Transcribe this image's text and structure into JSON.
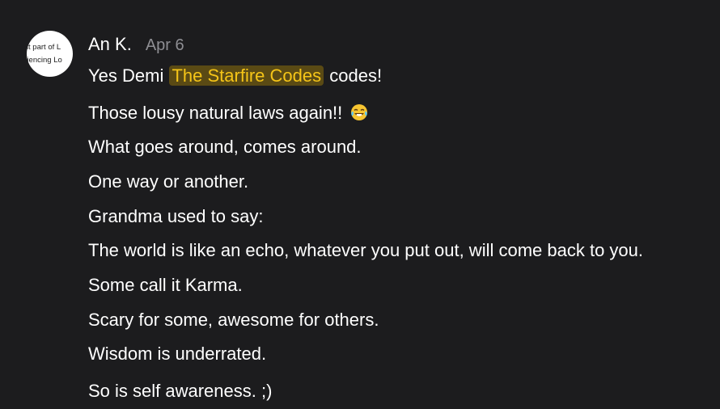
{
  "avatar": {
    "line1": "est part of L",
    "line2": "eriencing Lo"
  },
  "comment": {
    "author": "An K.",
    "date": "Apr 6",
    "first_line": {
      "before": "Yes Demi",
      "mention": "The Starfire Codes",
      "after": "codes!"
    },
    "lines": [
      "Those lousy natural laws again!!",
      "What goes around, comes around.",
      "One way or another.",
      "Grandma used to say:",
      "The world is like an echo, whatever you put out, will come back to you.",
      "Some call it Karma.",
      "Scary for some, awesome for others.",
      "Wisdom is underrated.",
      "So is self awareness. ;)"
    ],
    "emoji": "tears-of-joy-emoji"
  },
  "colors": {
    "background": "#1c1c1e",
    "text": "#ffffff",
    "date": "#8e8e93",
    "mention_text": "#f5c518",
    "mention_bg": "#5a4a14"
  }
}
